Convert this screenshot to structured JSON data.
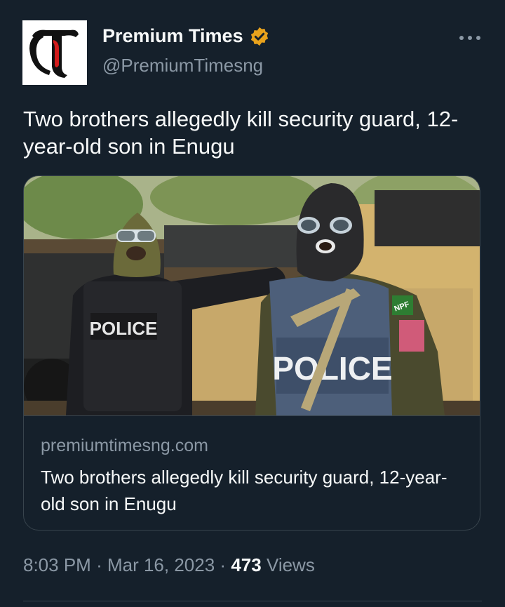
{
  "author": {
    "name": "Premium Times",
    "handle": "@PremiumTimesng",
    "avatar_icon": "premium-times-logo",
    "verified_icon": "gold-verified-badge",
    "verified_color": "#e8a21c"
  },
  "tweet": {
    "text": "Two brothers allegedly kill security guard, 12-year-old son in Enugu"
  },
  "card": {
    "image_text_left": "POLICE",
    "image_text_right": "POLICE",
    "image_badge": "NPF",
    "domain": "premiumtimesng.com",
    "title": "Two brothers allegedly kill security guard, 12-year-old son in Enugu"
  },
  "meta": {
    "time": "8:03 PM",
    "separator": "·",
    "date": "Mar 16, 2023",
    "views_count": "473",
    "views_label": "Views"
  },
  "colors": {
    "background": "#15202b",
    "text": "#f7f9f9",
    "secondary_text": "#8b98a5",
    "border": "#38444d"
  }
}
